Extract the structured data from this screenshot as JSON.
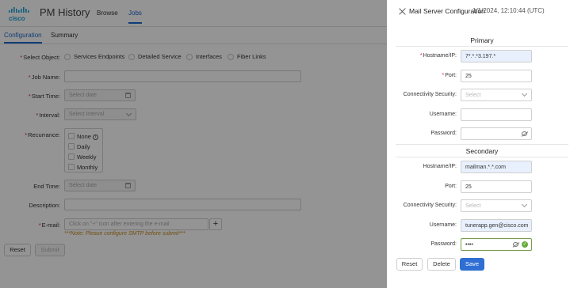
{
  "app": {
    "brand": "cisco",
    "title": "PM History",
    "nav": [
      "Browse",
      "Jobs"
    ],
    "active_nav": "Jobs"
  },
  "tabs": [
    "Configuration",
    "Summary"
  ],
  "form": {
    "select_object_label": "Select Object:",
    "object_options": [
      "Services Endpoints",
      "Detailed Service",
      "Interfaces",
      "Fiber Links"
    ],
    "job_name_label": "Job Name:",
    "start_time_label": "Start Time:",
    "start_time_placeholder": "Select date",
    "interval_label": "Interval:",
    "interval_placeholder": "Select Interval",
    "recurrance_label": "Recurrance:",
    "recurrance_options": [
      "None",
      "Daily",
      "Weekly",
      "Monthly"
    ],
    "end_time_label": "End Time:",
    "end_time_placeholder": "Select date",
    "description_label": "Description:",
    "email_label": "E-mail:",
    "email_placeholder": "Click on \"+\" icon after entering the e-mail",
    "plus": "+",
    "note": "***Note: Please configure SMTP before submit***",
    "reset": "Reset",
    "submit": "Submit"
  },
  "drawer": {
    "title": "Mail Server Configuration",
    "timestamp": "1/1/2024, 12:10:44 (UTC)",
    "primary": {
      "heading": "Primary",
      "hostname_label": "Hostname/IP:",
      "hostname_value": "7*.*.*3.197.*",
      "port_label": "Port:",
      "port_value": "25",
      "security_label": "Connectivity Security:",
      "security_placeholder": "Select",
      "username_label": "Username:",
      "password_label": "Password:"
    },
    "secondary": {
      "heading": "Secondary",
      "hostname_label": "Hostname/IP:",
      "hostname_value": "mailman.*.*.com",
      "port_label": "Port:",
      "port_value": "25",
      "security_label": "Connectivity Security:",
      "security_placeholder": "Select",
      "username_label": "Username:",
      "username_value": "tunerapp.gen@cisco.com",
      "password_label": "Password:",
      "password_value": "••••"
    },
    "buttons": {
      "reset": "Reset",
      "delete": "Delete",
      "save": "Save"
    }
  },
  "colors": {
    "accent": "#1d69cc",
    "save": "#2f6fd3",
    "required": "#d3243a",
    "note": "#c38a1f",
    "valid": "#6aab3c"
  }
}
